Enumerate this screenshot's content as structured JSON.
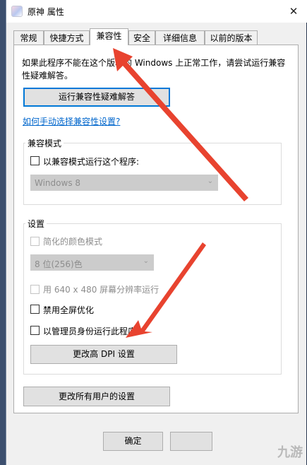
{
  "window": {
    "title": "原神 属性",
    "close_glyph": "✕"
  },
  "tabs": [
    {
      "label": "常规"
    },
    {
      "label": "快捷方式"
    },
    {
      "label": "兼容性"
    },
    {
      "label": "安全"
    },
    {
      "label": "详细信息"
    },
    {
      "label": "以前的版本"
    }
  ],
  "active_tab": "兼容性",
  "compat": {
    "intro": "如果此程序不能在这个版本的 Windows 上正常工作，请尝试运行兼容性疑难解答。",
    "troubleshoot_button": "运行兼容性疑难解答",
    "manual_link": "如何手动选择兼容性设置?",
    "mode_group_label": "兼容模式",
    "mode_checkbox_label": "以兼容模式运行这个程序:",
    "mode_checked": false,
    "os_select": "Windows 8"
  },
  "settings": {
    "group_label": "设置",
    "reduced_color_label": "简化的颜色模式",
    "color_depth_select": "8 位(256)色",
    "resolution_label": "用 640 x 480 屏幕分辨率运行",
    "fullscreen_opt_label": "禁用全屏优化",
    "admin_label": "以管理员身份运行此程序",
    "dpi_button": "更改高 DPI 设置"
  },
  "all_users_button": "更改所有用户的设置",
  "footer": {
    "ok_button": "确定"
  },
  "watermark": "九游",
  "colors": {
    "arrow": "#e8432f",
    "link": "#0066cc",
    "focus": "#0078d7"
  }
}
